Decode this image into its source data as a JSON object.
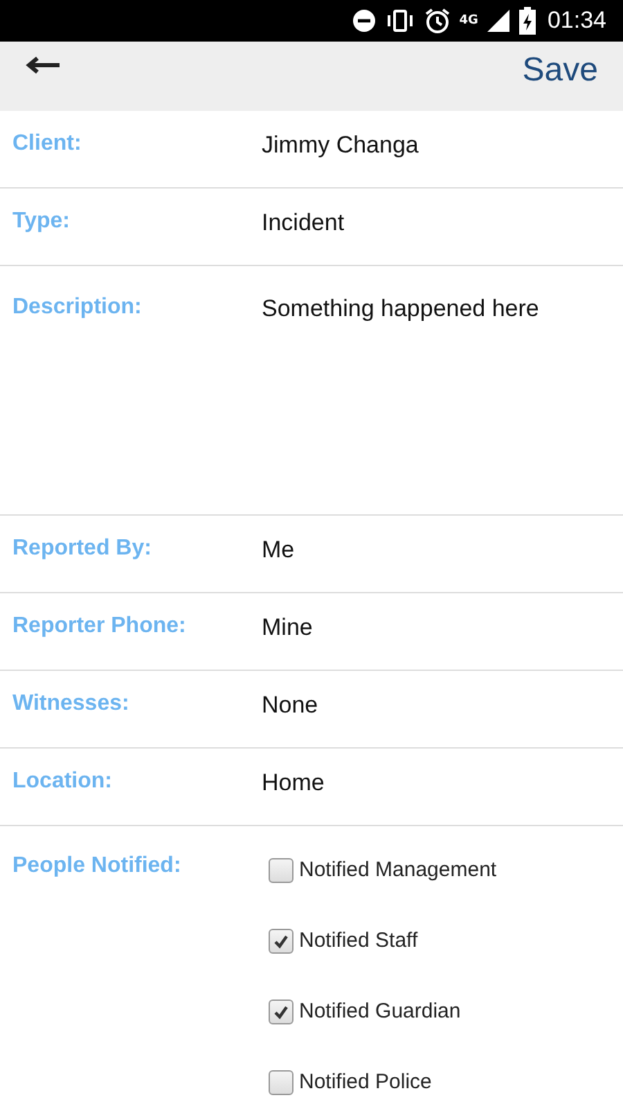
{
  "status_bar": {
    "network": "4G",
    "time": "01:34"
  },
  "header": {
    "save": "Save"
  },
  "fields": [
    {
      "kind": "text",
      "label": "Client:",
      "value": "Jimmy Changa"
    },
    {
      "kind": "text",
      "label": "Type:",
      "value": "Incident"
    },
    {
      "kind": "textarea",
      "label": "Description:",
      "value": "Something happened here"
    },
    {
      "kind": "text",
      "label": "Reported By:",
      "value": "Me"
    },
    {
      "kind": "text",
      "label": "Reporter Phone:",
      "value": "Mine"
    },
    {
      "kind": "text",
      "label": "Witnesses:",
      "value": "None"
    },
    {
      "kind": "text",
      "label": "Location:",
      "value": "Home"
    },
    {
      "kind": "checks",
      "label": "People Notified:",
      "options": [
        {
          "label": "Notified Management",
          "checked": false
        },
        {
          "label": "Notified Staff",
          "checked": true
        },
        {
          "label": "Notified Guardian",
          "checked": true
        },
        {
          "label": "Notified Police",
          "checked": false
        }
      ]
    }
  ]
}
